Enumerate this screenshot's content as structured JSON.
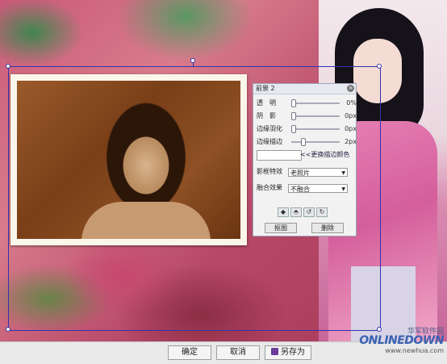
{
  "panel": {
    "title": "前景 2",
    "close_glyph": "×",
    "rows": [
      {
        "label": "透　明",
        "value": "0%",
        "level": 0
      },
      {
        "label": "阴　影",
        "value": "0px",
        "level": 0
      },
      {
        "label": "边缘羽化",
        "value": "0px",
        "level": 0
      },
      {
        "label": "边缘描边",
        "value": "2px",
        "level": 0.2
      }
    ],
    "change_color_link": "<<更换描边颜色",
    "effect_label": "影框特效",
    "effect_value": "老照片",
    "blend_label": "融合效果",
    "blend_value": "不融合",
    "layer_icons": [
      "bring-forward-icon",
      "send-backward-icon",
      "rotate-left-icon",
      "rotate-right-icon"
    ],
    "cutout_button": "抠图",
    "delete_button": "删除"
  },
  "bottom_bar": {
    "confirm": "确定",
    "cancel": "取消",
    "save_as": "另存为"
  },
  "watermark": {
    "chinese": "华军软件园",
    "logo": "ONLINEDOWN",
    "url": "www.newhua.com"
  },
  "colors": {
    "selection_border": "#3333aa",
    "panel_bg": "#f2f2f2",
    "bottom_bar_bg": "#e9e9e9"
  }
}
